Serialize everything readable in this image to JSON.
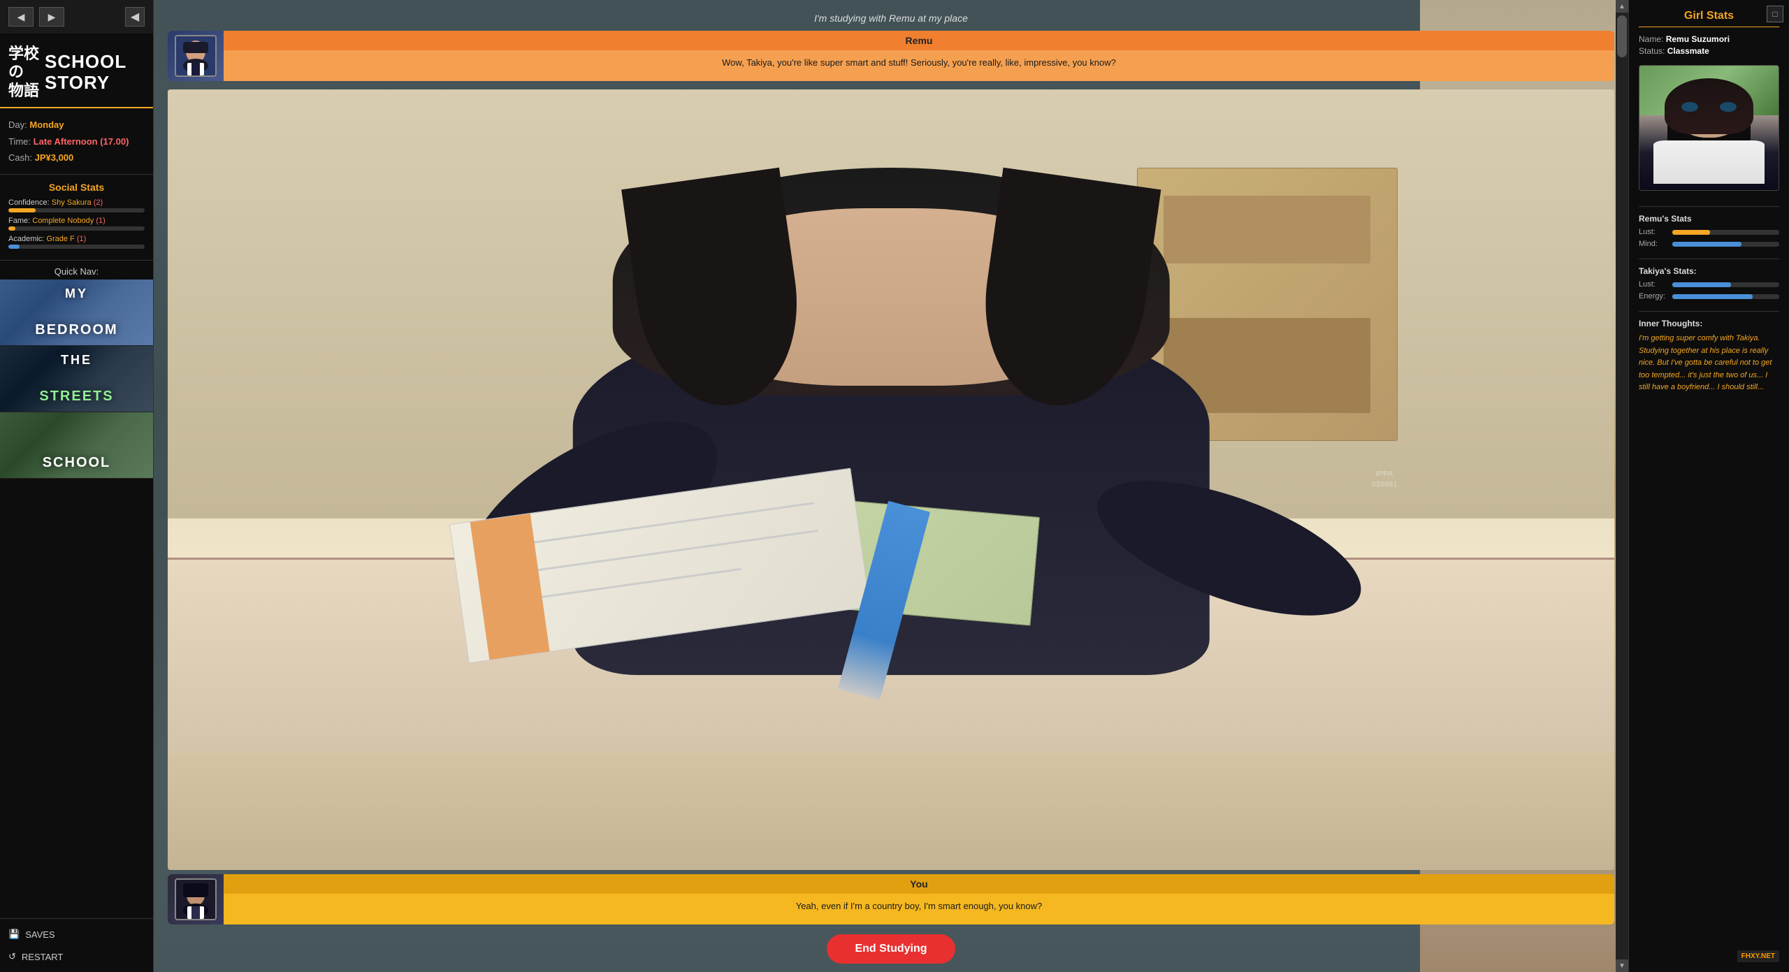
{
  "window": {
    "title": "School Story"
  },
  "nav_arrows": {
    "back": "◀",
    "forward": "▶",
    "collapse": "◀"
  },
  "logo": {
    "kanji_line1": "学校",
    "kanji_line2": "の",
    "kanji_line3": "物語",
    "english_line1": "SCHOOL",
    "english_line2": "STORY"
  },
  "player_stats": {
    "day_label": "Day:",
    "day_value": "Monday",
    "time_label": "Time:",
    "time_value": "Late Afternoon (17.00)",
    "cash_label": "Cash:",
    "cash_value": "JP¥3,000"
  },
  "social_stats": {
    "title": "Social Stats",
    "confidence_label": "Confidence:",
    "confidence_value": "Shy Sakura",
    "confidence_num": "(2)",
    "confidence_pct": 20,
    "fame_label": "Fame:",
    "fame_value": "Complete Nobody",
    "fame_num": "(1)",
    "fame_pct": 5,
    "academic_label": "Academic:",
    "academic_value": "Grade F",
    "academic_num": "(1)",
    "academic_pct": 8
  },
  "quick_nav": {
    "title": "Quick Nav:",
    "locations": [
      {
        "id": "bedroom",
        "line1": "MY",
        "line2": "BEDROOM",
        "color_class": "bedroom-nav-bg",
        "text_color": "white"
      },
      {
        "id": "streets",
        "line1": "THE",
        "line2": "STREETS",
        "color_class": "streets-nav-bg",
        "text_color": "#90ee90"
      },
      {
        "id": "school",
        "line1": "",
        "line2": "SCHOOL",
        "color_class": "school-nav-bg",
        "text_color": "white"
      }
    ]
  },
  "sidebar_bottom": {
    "saves_icon": "💾",
    "saves_label": "SAVES",
    "restart_icon": "↺",
    "restart_label": "RESTART"
  },
  "scene": {
    "header_text": "I'm studying with Remu at my place"
  },
  "dialog_remu": {
    "speaker": "Remu",
    "text": "Wow, Takiya, you're like super smart and stuff! Seriously, you're really, like, impressive, you know?"
  },
  "dialog_you": {
    "speaker": "You",
    "text": "Yeah, even if I'm a country boy, I'm smart enough, you know?"
  },
  "end_button": {
    "label": "End Studying"
  },
  "right_sidebar": {
    "title": "Girl Stats",
    "name_label": "Name:",
    "name_value": "Remu Suzumori",
    "status_label": "Status:",
    "status_value": "Classmate",
    "remu_stats_title": "Remu's Stats",
    "remu_lust_label": "Lust:",
    "remu_lust_pct": 35,
    "remu_mind_label": "Mind:",
    "remu_mind_pct": 65,
    "takiya_stats_title": "Takiya's Stats:",
    "takiya_lust_label": "Lust:",
    "takiya_lust_pct": 55,
    "takiya_energy_label": "Energy:",
    "takiya_energy_pct": 75,
    "inner_thoughts_title": "Inner Thoughts:",
    "inner_thoughts_text": "I'm getting super comfy with Takiya. Studying together at his place is really nice. But I've gotta be careful not to get too tempted... it's just the two of us... I still have a boyfriend... I should still..."
  },
  "watermark": {
    "line1": "IPPA",
    "line2": "020001"
  }
}
